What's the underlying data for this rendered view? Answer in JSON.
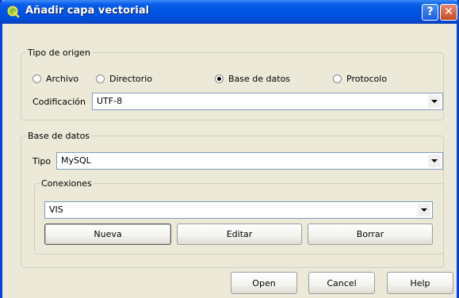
{
  "window": {
    "title": "Añadir capa vectorial"
  },
  "source_type": {
    "legend": "Tipo de origen",
    "options": [
      {
        "label": "Archivo",
        "selected": false
      },
      {
        "label": "Directorio",
        "selected": false
      },
      {
        "label": "Base de datos",
        "selected": true
      },
      {
        "label": "Protocolo",
        "selected": false
      }
    ],
    "encoding_label": "Codificación",
    "encoding_value": "UTF-8"
  },
  "database": {
    "legend": "Base de datos",
    "type_label": "Tipo",
    "type_value": "MySQL",
    "connections": {
      "legend": "Conexiones",
      "value": "VIS",
      "new_label": "Nueva",
      "edit_label": "Editar",
      "delete_label": "Borrar"
    }
  },
  "footer": {
    "open_label": "Open",
    "cancel_label": "Cancel",
    "help_label": "Help"
  },
  "icons": {
    "app": "qgis-icon",
    "help": "help-icon",
    "close": "close-icon",
    "dropdown": "chevron-down-icon"
  },
  "colors": {
    "titlebar": "#0054e3",
    "window_bg": "#ece9d8",
    "close_button": "#c74a25"
  }
}
